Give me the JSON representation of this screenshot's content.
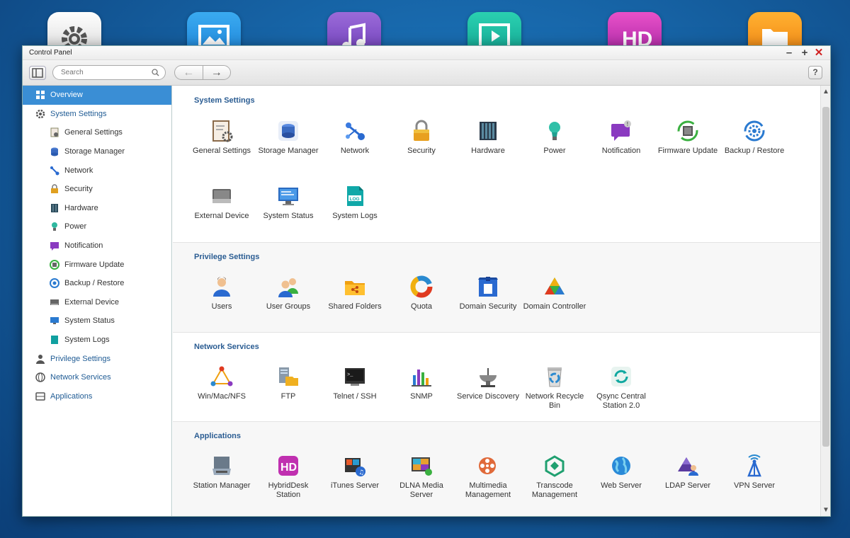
{
  "window": {
    "title": "Control Panel"
  },
  "toolbar": {
    "search_placeholder": "Search",
    "back": "←",
    "forward": "→",
    "help": "?"
  },
  "sidebar": {
    "overview": "Overview",
    "system_settings": "System Settings",
    "sub_items": [
      "General Settings",
      "Storage Manager",
      "Network",
      "Security",
      "Hardware",
      "Power",
      "Notification",
      "Firmware Update",
      "Backup / Restore",
      "External Device",
      "System Status",
      "System Logs"
    ],
    "privilege_settings": "Privilege Settings",
    "network_services": "Network Services",
    "applications": "Applications"
  },
  "sections": {
    "system": {
      "title": "System Settings",
      "items": [
        "General Settings",
        "Storage Manager",
        "Network",
        "Security",
        "Hardware",
        "Power",
        "Notification",
        "Firmware Update",
        "Backup / Restore",
        "External Device",
        "System Status",
        "System Logs"
      ]
    },
    "privilege": {
      "title": "Privilege Settings",
      "items": [
        "Users",
        "User Groups",
        "Shared Folders",
        "Quota",
        "Domain Security",
        "Domain Controller"
      ]
    },
    "network": {
      "title": "Network Services",
      "items": [
        "Win/Mac/NFS",
        "FTP",
        "Telnet / SSH",
        "SNMP",
        "Service Discovery",
        "Network Recycle Bin",
        "Qsync Central Station 2.0"
      ]
    },
    "apps": {
      "title": "Applications",
      "items": [
        "Station Manager",
        "HybridDesk Station",
        "iTunes Server",
        "DLNA Media Server",
        "Multimedia Management",
        "Transcode Management",
        "Web Server",
        "LDAP Server",
        "VPN Server"
      ]
    }
  },
  "colors": {
    "accent": "#3a8ed5",
    "section_title": "#2a5c92",
    "close": "#d02020"
  }
}
